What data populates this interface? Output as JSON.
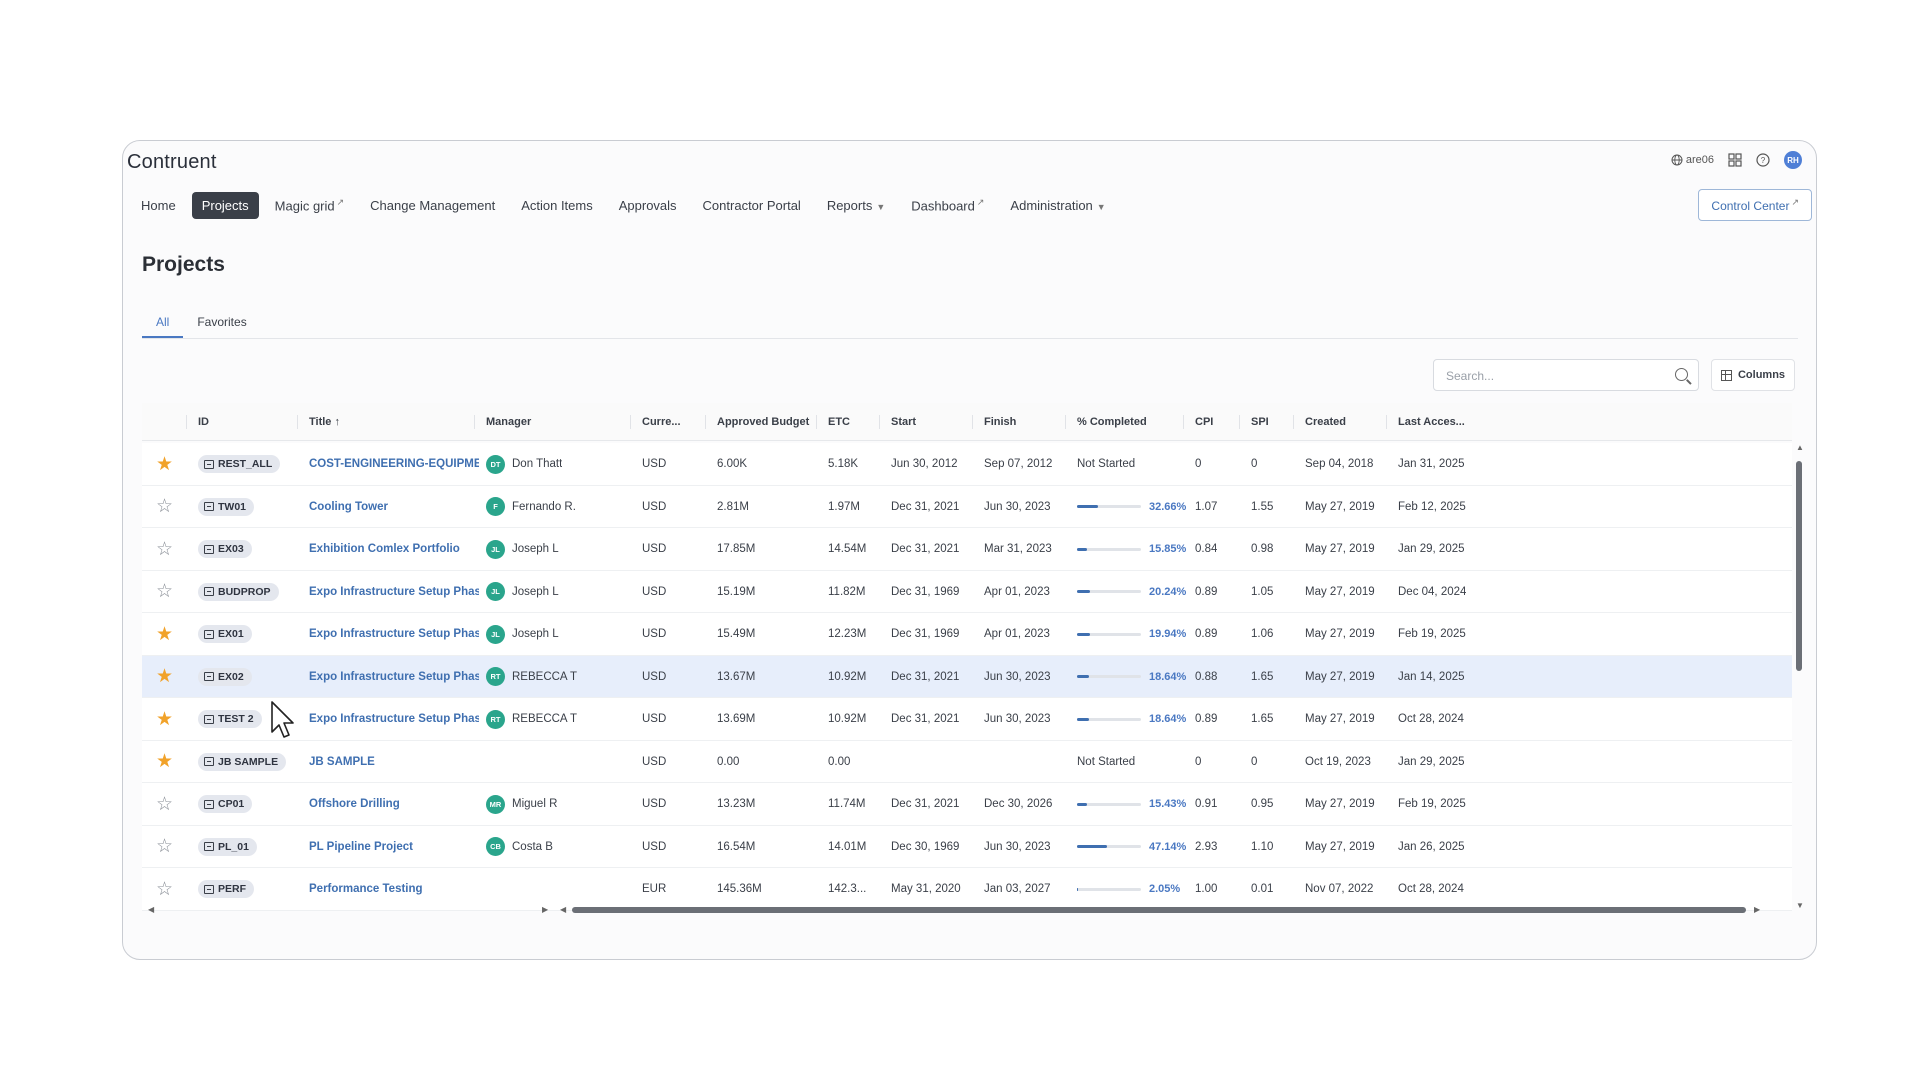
{
  "app": {
    "logo": "Contruent",
    "user_region": "are06",
    "user_initials": "RH",
    "control_center": "Control Center"
  },
  "nav": [
    {
      "label": "Home",
      "active": false,
      "suffix": ""
    },
    {
      "label": "Projects",
      "active": true,
      "suffix": ""
    },
    {
      "label": "Magic grid",
      "active": false,
      "suffix": "ext"
    },
    {
      "label": "Change Management",
      "active": false,
      "suffix": ""
    },
    {
      "label": "Action Items",
      "active": false,
      "suffix": ""
    },
    {
      "label": "Approvals",
      "active": false,
      "suffix": ""
    },
    {
      "label": "Contractor Portal",
      "active": false,
      "suffix": ""
    },
    {
      "label": "Reports",
      "active": false,
      "suffix": "caret"
    },
    {
      "label": "Dashboard",
      "active": false,
      "suffix": "ext"
    },
    {
      "label": "Administration",
      "active": false,
      "suffix": "caret"
    }
  ],
  "page": {
    "title": "Projects",
    "tabs": [
      {
        "label": "All",
        "active": true
      },
      {
        "label": "Favorites",
        "active": false
      }
    ],
    "search_placeholder": "Search...",
    "columns_label": "Columns"
  },
  "columns": [
    "ID",
    "Title",
    "Manager",
    "Curre...",
    "Approved Budget",
    "ETC",
    "Start",
    "Finish",
    "% Completed",
    "CPI",
    "SPI",
    "Created",
    "Last Acces..."
  ],
  "rows": [
    {
      "fav": true,
      "id": "REST_ALL",
      "title": "COST-ENGINEERING-EQUIPME...",
      "mgr_initials": "DT",
      "manager": "Don Thatt",
      "currency": "USD",
      "budget": "6.00K",
      "etc": "5.18K",
      "start": "Jun 30, 2012",
      "finish": "Sep 07, 2012",
      "pct_text": "Not Started",
      "pct": null,
      "cpi": "0",
      "spi": "0",
      "created": "Sep 04, 2018",
      "last": "Jan 31, 2025",
      "selected": false
    },
    {
      "fav": false,
      "id": "TW01",
      "title": "Cooling Tower",
      "mgr_initials": "F",
      "manager": "Fernando R.",
      "currency": "USD",
      "budget": "2.81M",
      "etc": "1.97M",
      "start": "Dec 31, 2021",
      "finish": "Jun 30, 2023",
      "pct_text": "32.66%",
      "pct": 32.66,
      "cpi": "1.07",
      "spi": "1.55",
      "created": "May 27, 2019",
      "last": "Feb 12, 2025",
      "selected": false
    },
    {
      "fav": false,
      "id": "EX03",
      "title": "Exhibition Comlex Portfolio",
      "mgr_initials": "JL",
      "manager": "Joseph L",
      "currency": "USD",
      "budget": "17.85M",
      "etc": "14.54M",
      "start": "Dec 31, 2021",
      "finish": "Mar 31, 2023",
      "pct_text": "15.85%",
      "pct": 15.85,
      "cpi": "0.84",
      "spi": "0.98",
      "created": "May 27, 2019",
      "last": "Jan 29, 2025",
      "selected": false
    },
    {
      "fav": false,
      "id": "BUDPROP",
      "title": "Expo Infrastructure Setup Phas...",
      "mgr_initials": "JL",
      "manager": "Joseph L",
      "currency": "USD",
      "budget": "15.19M",
      "etc": "11.82M",
      "start": "Dec 31, 1969",
      "finish": "Apr 01, 2023",
      "pct_text": "20.24%",
      "pct": 20.24,
      "cpi": "0.89",
      "spi": "1.05",
      "created": "May 27, 2019",
      "last": "Dec 04, 2024",
      "selected": false
    },
    {
      "fav": true,
      "id": "EX01",
      "title": "Expo Infrastructure Setup Phas...",
      "mgr_initials": "JL",
      "manager": "Joseph L",
      "currency": "USD",
      "budget": "15.49M",
      "etc": "12.23M",
      "start": "Dec 31, 1969",
      "finish": "Apr 01, 2023",
      "pct_text": "19.94%",
      "pct": 19.94,
      "cpi": "0.89",
      "spi": "1.06",
      "created": "May 27, 2019",
      "last": "Feb 19, 2025",
      "selected": false
    },
    {
      "fav": true,
      "id": "EX02",
      "title": "Expo Infrastructure Setup Phas...",
      "mgr_initials": "RT",
      "manager": "REBECCA T",
      "currency": "USD",
      "budget": "13.67M",
      "etc": "10.92M",
      "start": "Dec 31, 2021",
      "finish": "Jun 30, 2023",
      "pct_text": "18.64%",
      "pct": 18.64,
      "cpi": "0.88",
      "spi": "1.65",
      "created": "May 27, 2019",
      "last": "Jan 14, 2025",
      "selected": true
    },
    {
      "fav": true,
      "id": "TEST 2",
      "title": "Expo Infrastructure Setup Phas...",
      "mgr_initials": "RT",
      "manager": "REBECCA T",
      "currency": "USD",
      "budget": "13.69M",
      "etc": "10.92M",
      "start": "Dec 31, 2021",
      "finish": "Jun 30, 2023",
      "pct_text": "18.64%",
      "pct": 18.64,
      "cpi": "0.89",
      "spi": "1.65",
      "created": "May 27, 2019",
      "last": "Oct 28, 2024",
      "selected": false
    },
    {
      "fav": true,
      "id": "JB SAMPLE",
      "title": "JB SAMPLE",
      "mgr_initials": "",
      "manager": "",
      "currency": "USD",
      "budget": "0.00",
      "etc": "0.00",
      "start": "",
      "finish": "",
      "pct_text": "Not Started",
      "pct": null,
      "cpi": "0",
      "spi": "0",
      "created": "Oct 19, 2023",
      "last": "Jan 29, 2025",
      "selected": false
    },
    {
      "fav": false,
      "id": "CP01",
      "title": "Offshore Drilling",
      "mgr_initials": "MR",
      "manager": "Miguel R",
      "currency": "USD",
      "budget": "13.23M",
      "etc": "11.74M",
      "start": "Dec 31, 2021",
      "finish": "Dec 30, 2026",
      "pct_text": "15.43%",
      "pct": 15.43,
      "cpi": "0.91",
      "spi": "0.95",
      "created": "May 27, 2019",
      "last": "Feb 19, 2025",
      "selected": false
    },
    {
      "fav": false,
      "id": "PL_01",
      "title": "PL Pipeline Project",
      "mgr_initials": "CB",
      "manager": "Costa B",
      "currency": "USD",
      "budget": "16.54M",
      "etc": "14.01M",
      "start": "Dec 30, 1969",
      "finish": "Jun 30, 2023",
      "pct_text": "47.14%",
      "pct": 47.14,
      "cpi": "2.93",
      "spi": "1.10",
      "created": "May 27, 2019",
      "last": "Jan 26, 2025",
      "selected": false
    },
    {
      "fav": false,
      "id": "PERF",
      "title": "Performance Testing",
      "mgr_initials": "",
      "manager": "",
      "currency": "EUR",
      "budget": "145.36M",
      "etc": "142.3...",
      "start": "May 31, 2020",
      "finish": "Jan 03, 2027",
      "pct_text": "2.05%",
      "pct": 2.05,
      "cpi": "1.00",
      "spi": "0.01",
      "created": "Nov 07, 2022",
      "last": "Oct 28, 2024",
      "selected": false
    }
  ],
  "colors": {
    "accent": "#3f6fb0",
    "favorite": "#f1a22a",
    "selected_row": "#e7eefb",
    "manager_avatar": "#2aa58c"
  }
}
